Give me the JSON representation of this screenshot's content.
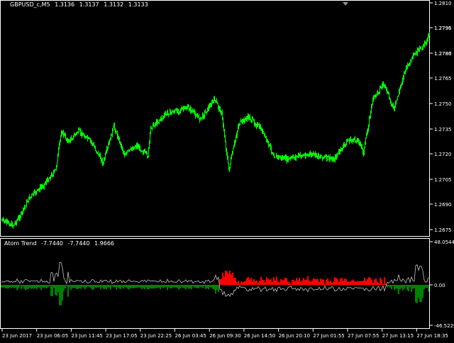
{
  "price_panel": {
    "symbol_label": "GBPUSD_c,M5",
    "ohlc": [
      "1.3136",
      "1.3137",
      "1.3132",
      "1.3133"
    ],
    "candle_color": "#00ff00",
    "price_ticks": [
      "1.2810",
      "1.2795",
      "1.2780",
      "1.2765",
      "1.2750",
      "1.2735",
      "1.2720",
      "1.2705",
      "1.2690",
      "1.2675"
    ],
    "current_price_labels": [
      "1.2796",
      "1.2786"
    ]
  },
  "indicator_panel": {
    "name": "Atom Trend",
    "values": [
      "-7.7440",
      "-7.7440",
      "1.9666"
    ],
    "scale_ticks": [
      "48.0544",
      "0.00",
      "-46.5229"
    ],
    "colors": {
      "up": "#ff0000",
      "down": "#008000",
      "line": "#c0c0c0"
    }
  },
  "time_axis": {
    "labels": [
      "23 Jun 2017",
      "23 Jun 06:05",
      "23 Jun 11:45",
      "23 Jun 17:05",
      "23 Jun 22:25",
      "26 Jun 03:45",
      "26 Jun 09:30",
      "26 Jun 14:50",
      "26 Jun 20:10",
      "27 Jun 01:55",
      "27 Jun 07:55",
      "27 Jun 13:15",
      "27 Jun 18:35"
    ]
  }
}
